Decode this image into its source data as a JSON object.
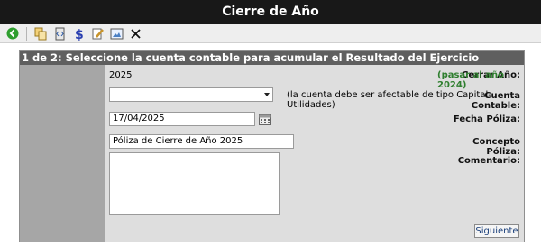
{
  "window": {
    "title": "Cierre de Año"
  },
  "toolbar": {
    "buttons": [
      {
        "icon": "back-arrow-icon",
        "color": "#2e9e2e"
      },
      {
        "icon": "copy-icon"
      },
      {
        "icon": "code-icon"
      },
      {
        "icon": "dollar-icon",
        "color": "#2a3fb0"
      },
      {
        "icon": "edit-icon"
      },
      {
        "icon": "image-icon"
      },
      {
        "icon": "close-icon"
      }
    ]
  },
  "panel": {
    "header": "1 de 2:  Seleccione la cuenta contable para acumular el Resultado del Ejercicio"
  },
  "form": {
    "cerrar_ano": {
      "label": "Cerrar Año:",
      "value": "2025"
    },
    "pasar_link": "(pasar al año 2024)",
    "cuenta": {
      "label": "Cuenta Contable:",
      "value": "",
      "hint": "(la cuenta debe ser afectable de tipo Capital-Utilidades)"
    },
    "fecha": {
      "label": "Fecha Póliza:",
      "value": "17/04/2025"
    },
    "concepto": {
      "label": "Concepto Póliza:",
      "value": "Póliza de Cierre de Año 2025"
    },
    "comentario": {
      "label": "Comentario:",
      "value": ""
    },
    "siguiente_button": "Siguiente"
  },
  "colors": {
    "titlebar": "#181818",
    "panel_header": "#5f5f5f",
    "label_column": "#a6a6a6",
    "panel_body": "#dedede",
    "green_link": "#2f7f2f"
  }
}
